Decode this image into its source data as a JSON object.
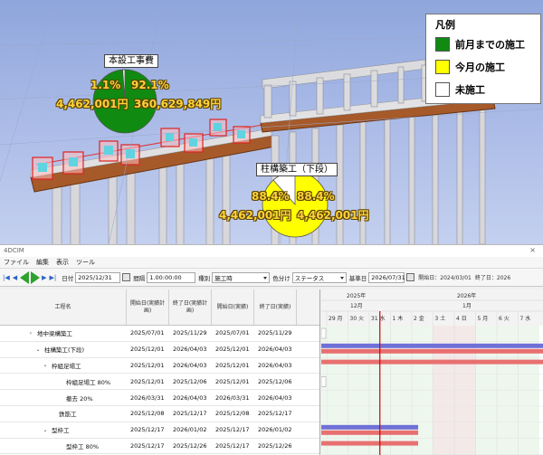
{
  "legend": {
    "title": "凡例",
    "items": [
      {
        "label": "前月までの施工",
        "color": "#108a10"
      },
      {
        "label": "今月の施工",
        "color": "#ffff00"
      },
      {
        "label": "未施工",
        "color": "#ffffff"
      }
    ]
  },
  "pies": [
    {
      "label": "本設工事費",
      "pct_white": "1.1%",
      "pct_main": "92.1%",
      "amount_white": "4,462,001円",
      "amount_main": "360,629,849円",
      "main_color": "#108a10",
      "white_fraction": 0.011
    },
    {
      "label": "柱構築工（下段）",
      "pct_white": "88.4%",
      "pct_main": "88.4%",
      "amount_white": "4,462,001円",
      "amount_main": "4,462,001円",
      "main_color": "#ffff00",
      "white_fraction": 0.116
    }
  ],
  "app": {
    "title": "4DCIM",
    "close": "×",
    "menu": [
      "ファイル",
      "編集",
      "表示",
      "ツール"
    ],
    "toolbar": {
      "date_label": "日付",
      "date_value": "2025/12/31",
      "interval_label": "間隔",
      "interval_value": "1.00:00:00",
      "type_label": "種別",
      "type_value": "施工時",
      "color_label": "色分け",
      "color_value": "ステータス",
      "base_label": "基準日",
      "base_value": "2026/07/31",
      "start_info": "開始日：2024/03/01",
      "end_info": "終了日：2026"
    }
  },
  "grid": {
    "headers": [
      "工程名",
      "開始日(実績計画)",
      "終了日(実績計画)",
      "開始日(実績)",
      "終了日(実績)"
    ],
    "rows": [
      {
        "caret": "›",
        "name": "地中梁構築工",
        "s_plan": "2025/07/01",
        "e_plan": "2025/11/29",
        "s_act": "2025/07/01",
        "e_act": "2025/11/29"
      },
      {
        "caret": "⌄",
        "name": "柱構築工(下段)",
        "s_plan": "2025/12/01",
        "e_plan": "2026/04/03",
        "s_act": "2025/12/01",
        "e_act": "2026/04/03"
      },
      {
        "caret": "⌄",
        "name": "枠組足場工",
        "s_plan": "2025/12/01",
        "e_plan": "2026/04/03",
        "s_act": "2025/12/01",
        "e_act": "2026/04/03"
      },
      {
        "caret": "",
        "name": "枠組足場工 80%",
        "s_plan": "2025/12/01",
        "e_plan": "2025/12/06",
        "s_act": "2025/12/01",
        "e_act": "2025/12/06"
      },
      {
        "caret": "",
        "name": "撤去 20%",
        "s_plan": "2026/03/31",
        "e_plan": "2026/04/03",
        "s_act": "2026/03/31",
        "e_act": "2026/04/03"
      },
      {
        "caret": "",
        "name": "鉄筋工",
        "s_plan": "2025/12/08",
        "e_plan": "2025/12/17",
        "s_act": "2025/12/08",
        "e_act": "2025/12/17"
      },
      {
        "caret": "⌄",
        "name": "型枠工",
        "s_plan": "2025/12/17",
        "e_plan": "2026/01/02",
        "s_act": "2025/12/17",
        "e_act": "2026/01/02"
      },
      {
        "caret": "",
        "name": "型枠工 80%",
        "s_plan": "2025/12/17",
        "e_plan": "2025/12/26",
        "s_act": "2025/12/17",
        "e_act": "2025/12/26"
      },
      {
        "caret": "",
        "name": "脱型 20%",
        "s_plan": "2026/01/01",
        "e_plan": "2026/01/02",
        "s_act": "2026/01/01",
        "e_act": "2026/01/02"
      }
    ]
  },
  "gantt": {
    "year_left": "2025年",
    "year_right": "2026年",
    "month_left": "12月",
    "month_right": "1月",
    "days": [
      "29 月",
      "30 火",
      "31 水",
      "1 木",
      "2 金",
      "3 土",
      "4 日",
      "5 月",
      "6 火",
      "7 水"
    ],
    "today_index": 2
  }
}
